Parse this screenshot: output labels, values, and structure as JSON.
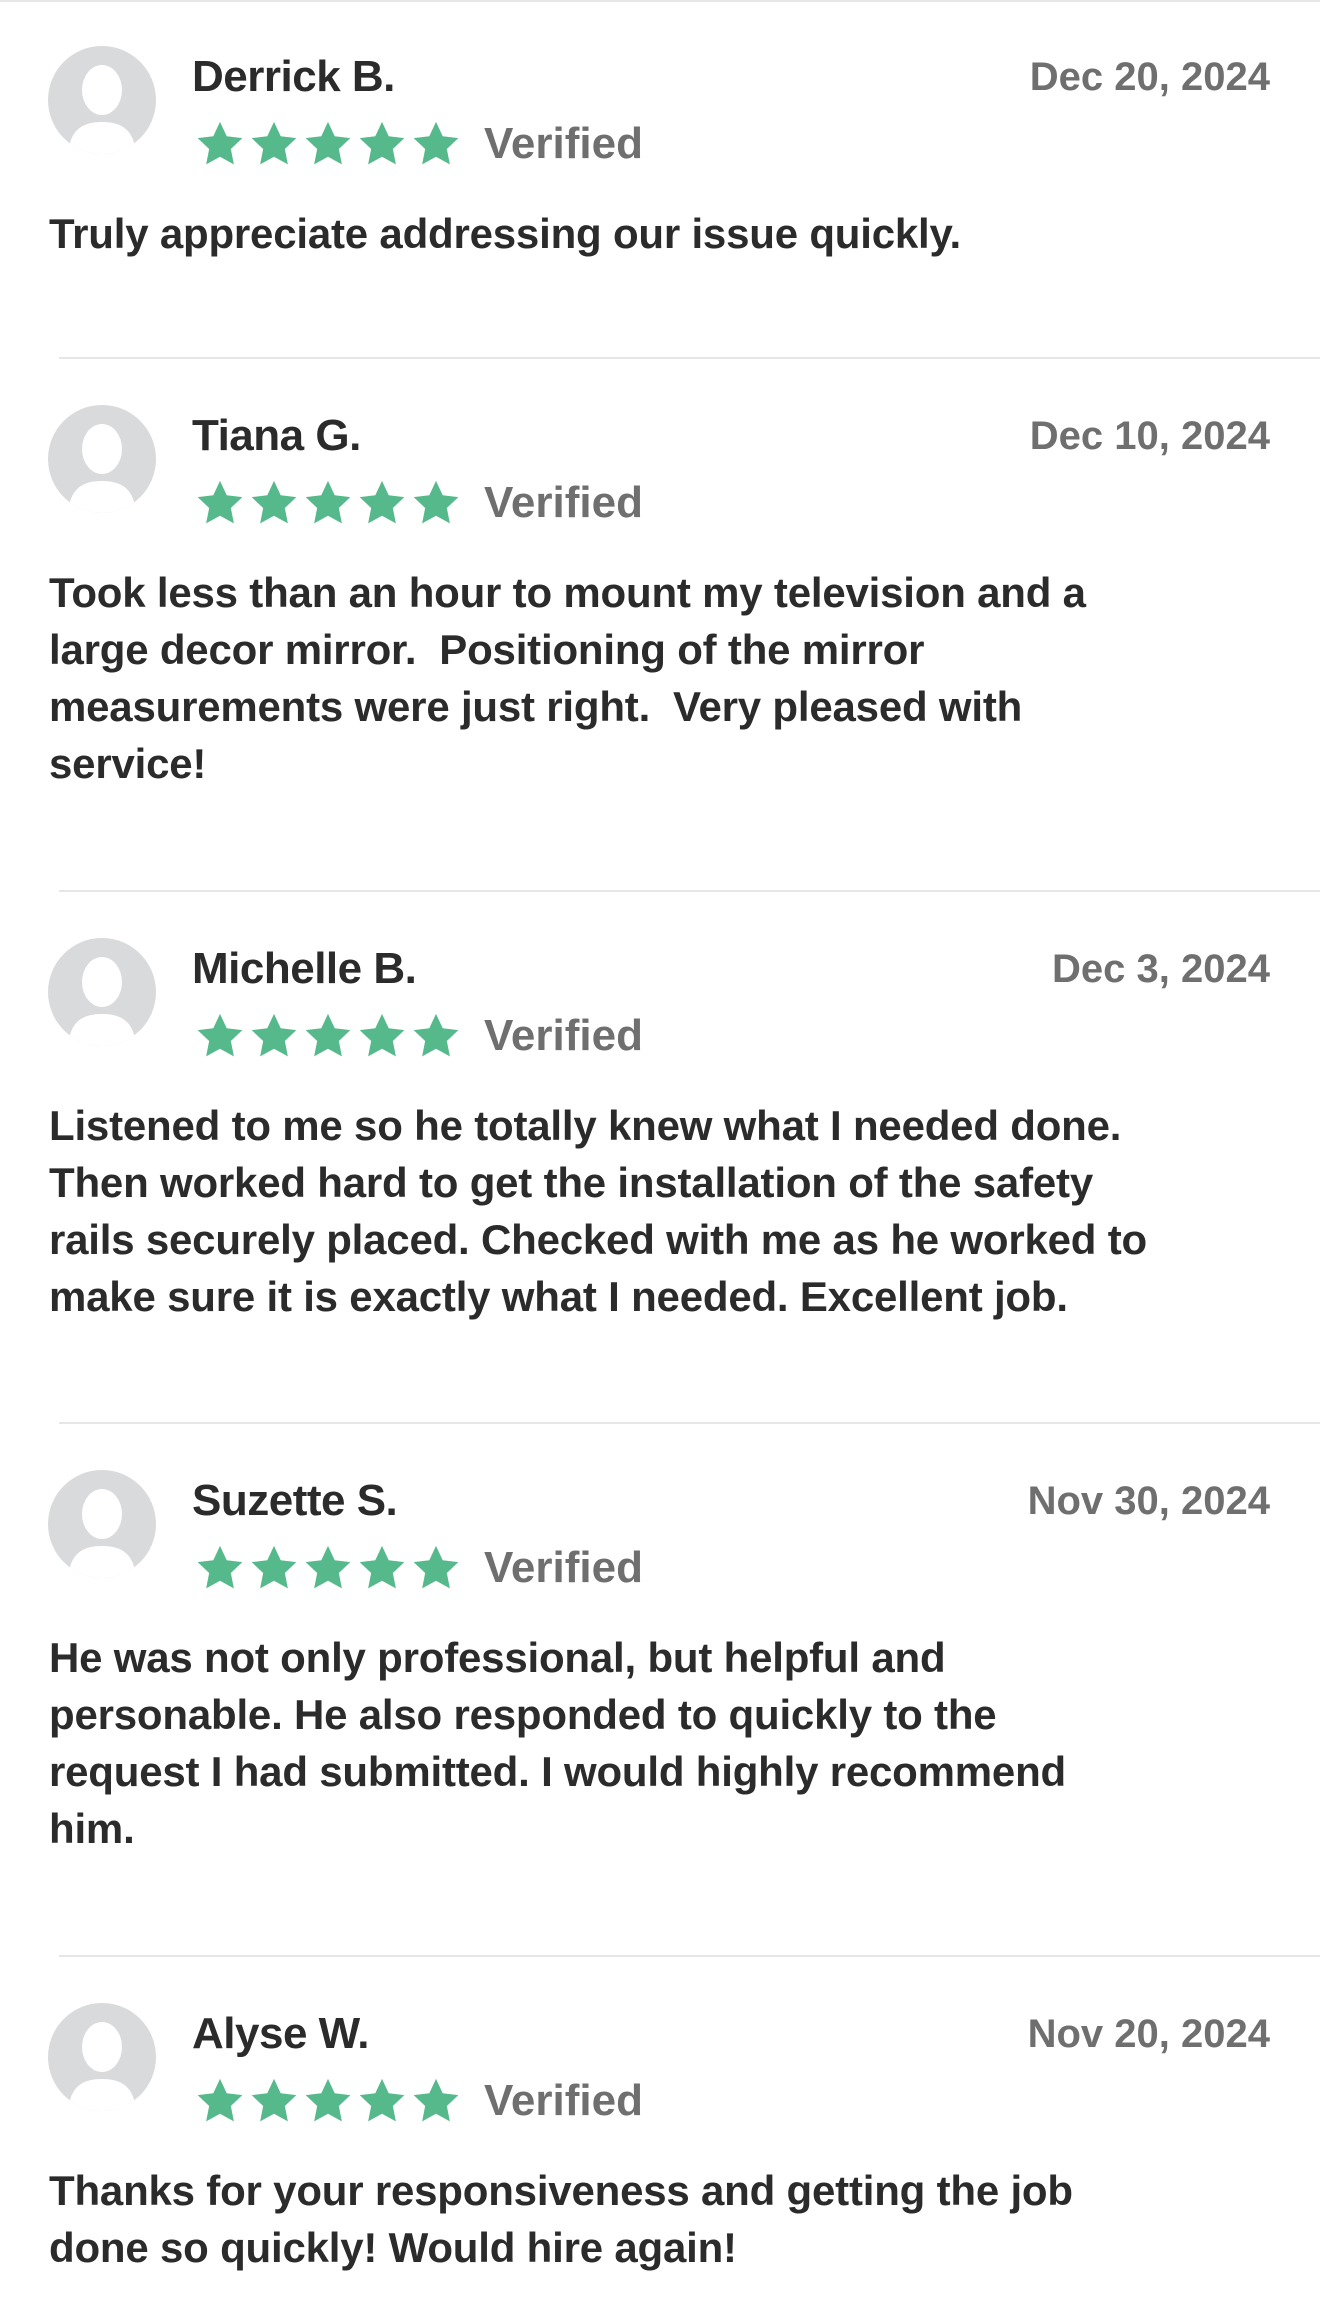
{
  "colors": {
    "star": "#56b98c",
    "name_text": "#2b2b2b",
    "meta_text": "#6f6f6f",
    "avatar_bg": "#d9dadc",
    "divider": "#e6e6e6"
  },
  "icons": {
    "avatar": "default-avatar-icon",
    "star": "star-icon"
  },
  "reviews": [
    {
      "name": "Derrick B.",
      "date": "Dec 20, 2024",
      "rating": 5,
      "verified_label": "Verified",
      "text": "Truly appreciate addressing our issue quickly."
    },
    {
      "name": "Tiana G.",
      "date": "Dec 10, 2024",
      "rating": 5,
      "verified_label": "Verified",
      "text": "Took less than an hour to mount my television and a\nlarge decor mirror.  Positioning of the mirror\nmeasurements were just right.  Very pleased with\nservice!"
    },
    {
      "name": "Michelle B.",
      "date": "Dec 3, 2024",
      "rating": 5,
      "verified_label": "Verified",
      "text": "Listened to me so he totally knew what I needed done.\nThen worked hard to get the installation of the safety\nrails securely placed. Checked with me as he worked to\nmake sure it is exactly what I needed. Excellent job."
    },
    {
      "name": "Suzette S.",
      "date": "Nov 30, 2024",
      "rating": 5,
      "verified_label": "Verified",
      "text": "He was not only professional, but helpful and\npersonable. He also responded to quickly to the\nrequest I had submitted. I would highly recommend\nhim."
    },
    {
      "name": "Alyse W.",
      "date": "Nov 20, 2024",
      "rating": 5,
      "verified_label": "Verified",
      "text": "Thanks for your responsiveness and getting the job\ndone so quickly! Would hire again!"
    }
  ]
}
